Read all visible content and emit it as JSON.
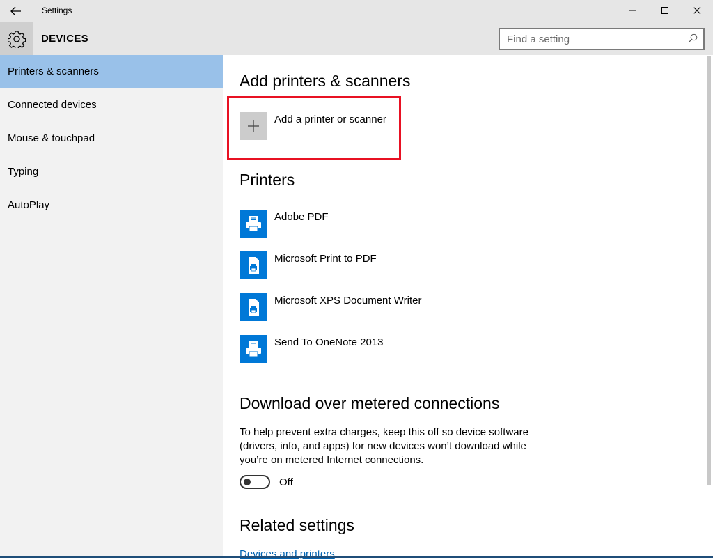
{
  "window": {
    "title": "Settings"
  },
  "header": {
    "section_title": "DEVICES",
    "search_placeholder": "Find a setting"
  },
  "sidebar": {
    "items": [
      {
        "label": "Printers & scanners"
      },
      {
        "label": "Connected devices"
      },
      {
        "label": "Mouse & touchpad"
      },
      {
        "label": "Typing"
      },
      {
        "label": "AutoPlay"
      }
    ],
    "active_index": 0
  },
  "main": {
    "add_heading": "Add printers & scanners",
    "add_label": "Add a printer or scanner",
    "printers_heading": "Printers",
    "printers": [
      {
        "label": "Adobe PDF"
      },
      {
        "label": "Microsoft Print to PDF"
      },
      {
        "label": "Microsoft XPS Document Writer"
      },
      {
        "label": "Send To OneNote 2013"
      }
    ],
    "metered_heading": "Download over metered connections",
    "metered_description": "To help prevent extra charges, keep this off so device software (drivers, info, and apps) for new devices won’t download while you’re on metered Internet connections.",
    "metered_toggle_state": "Off",
    "related_heading": "Related settings",
    "related_link": "Devices and printers"
  },
  "icons": {
    "back": "back-arrow-icon",
    "gear": "gear-icon",
    "search": "search-icon",
    "plus": "plus-icon",
    "printer": "printer-icon",
    "minimize": "minimize-icon",
    "maximize": "maximize-icon",
    "close": "close-icon"
  },
  "colors": {
    "accent": "#0078d7",
    "active_nav": "#99c1e9",
    "highlight_box": "#e81123",
    "link": "#0063b1"
  }
}
